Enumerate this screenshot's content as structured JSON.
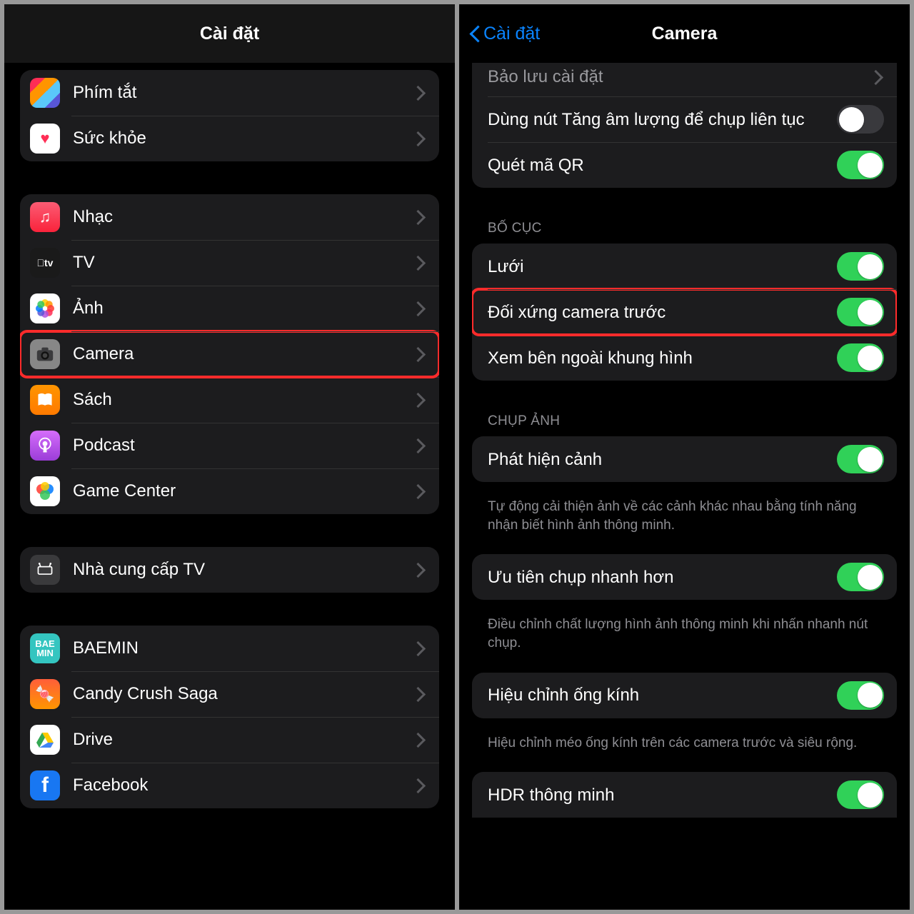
{
  "left": {
    "title": "Cài đặt",
    "groups": [
      {
        "items": [
          {
            "key": "shortcuts",
            "label": "Phím tắt"
          },
          {
            "key": "health",
            "label": "Sức khỏe"
          }
        ]
      },
      {
        "items": [
          {
            "key": "music",
            "label": "Nhạc"
          },
          {
            "key": "tv",
            "label": "TV"
          },
          {
            "key": "photos",
            "label": "Ảnh"
          },
          {
            "key": "camera",
            "label": "Camera",
            "highlight": true
          },
          {
            "key": "books",
            "label": "Sách"
          },
          {
            "key": "podcast",
            "label": "Podcast"
          },
          {
            "key": "gamecenter",
            "label": "Game Center"
          }
        ]
      },
      {
        "items": [
          {
            "key": "tvprovider",
            "label": "Nhà cung cấp TV"
          }
        ]
      },
      {
        "items": [
          {
            "key": "baemin",
            "label": "BAEMIN"
          },
          {
            "key": "candy",
            "label": "Candy Crush Saga"
          },
          {
            "key": "drive",
            "label": "Drive"
          },
          {
            "key": "facebook",
            "label": "Facebook"
          }
        ]
      }
    ]
  },
  "right": {
    "back": "Cài đặt",
    "title": "Camera",
    "top_group": {
      "items": [
        {
          "label": "Bảo lưu cài đặt",
          "type": "nav"
        },
        {
          "label": "Dùng nút Tăng âm lượng để chụp liên tục",
          "type": "toggle",
          "on": false
        },
        {
          "label": "Quét mã QR",
          "type": "toggle",
          "on": true
        }
      ]
    },
    "sections": [
      {
        "header": "BỐ CỤC",
        "items": [
          {
            "label": "Lưới",
            "on": true
          },
          {
            "label": "Đối xứng camera trước",
            "on": true,
            "highlight": true
          },
          {
            "label": "Xem bên ngoài khung hình",
            "on": true
          }
        ]
      },
      {
        "header": "CHỤP ẢNH",
        "items": [
          {
            "label": "Phát hiện cảnh",
            "on": true
          }
        ],
        "footer": "Tự động cải thiện ảnh về các cảnh khác nhau bằng tính năng nhận biết hình ảnh thông minh."
      },
      {
        "items": [
          {
            "label": "Ưu tiên chụp nhanh hơn",
            "on": true
          }
        ],
        "footer": "Điều chỉnh chất lượng hình ảnh thông minh khi nhấn nhanh nút chụp."
      },
      {
        "items": [
          {
            "label": "Hiệu chỉnh ống kính",
            "on": true
          }
        ],
        "footer": "Hiệu chỉnh méo ống kính trên các camera trước và siêu rộng."
      },
      {
        "items": [
          {
            "label": "HDR thông minh",
            "on": true
          }
        ]
      }
    ]
  }
}
